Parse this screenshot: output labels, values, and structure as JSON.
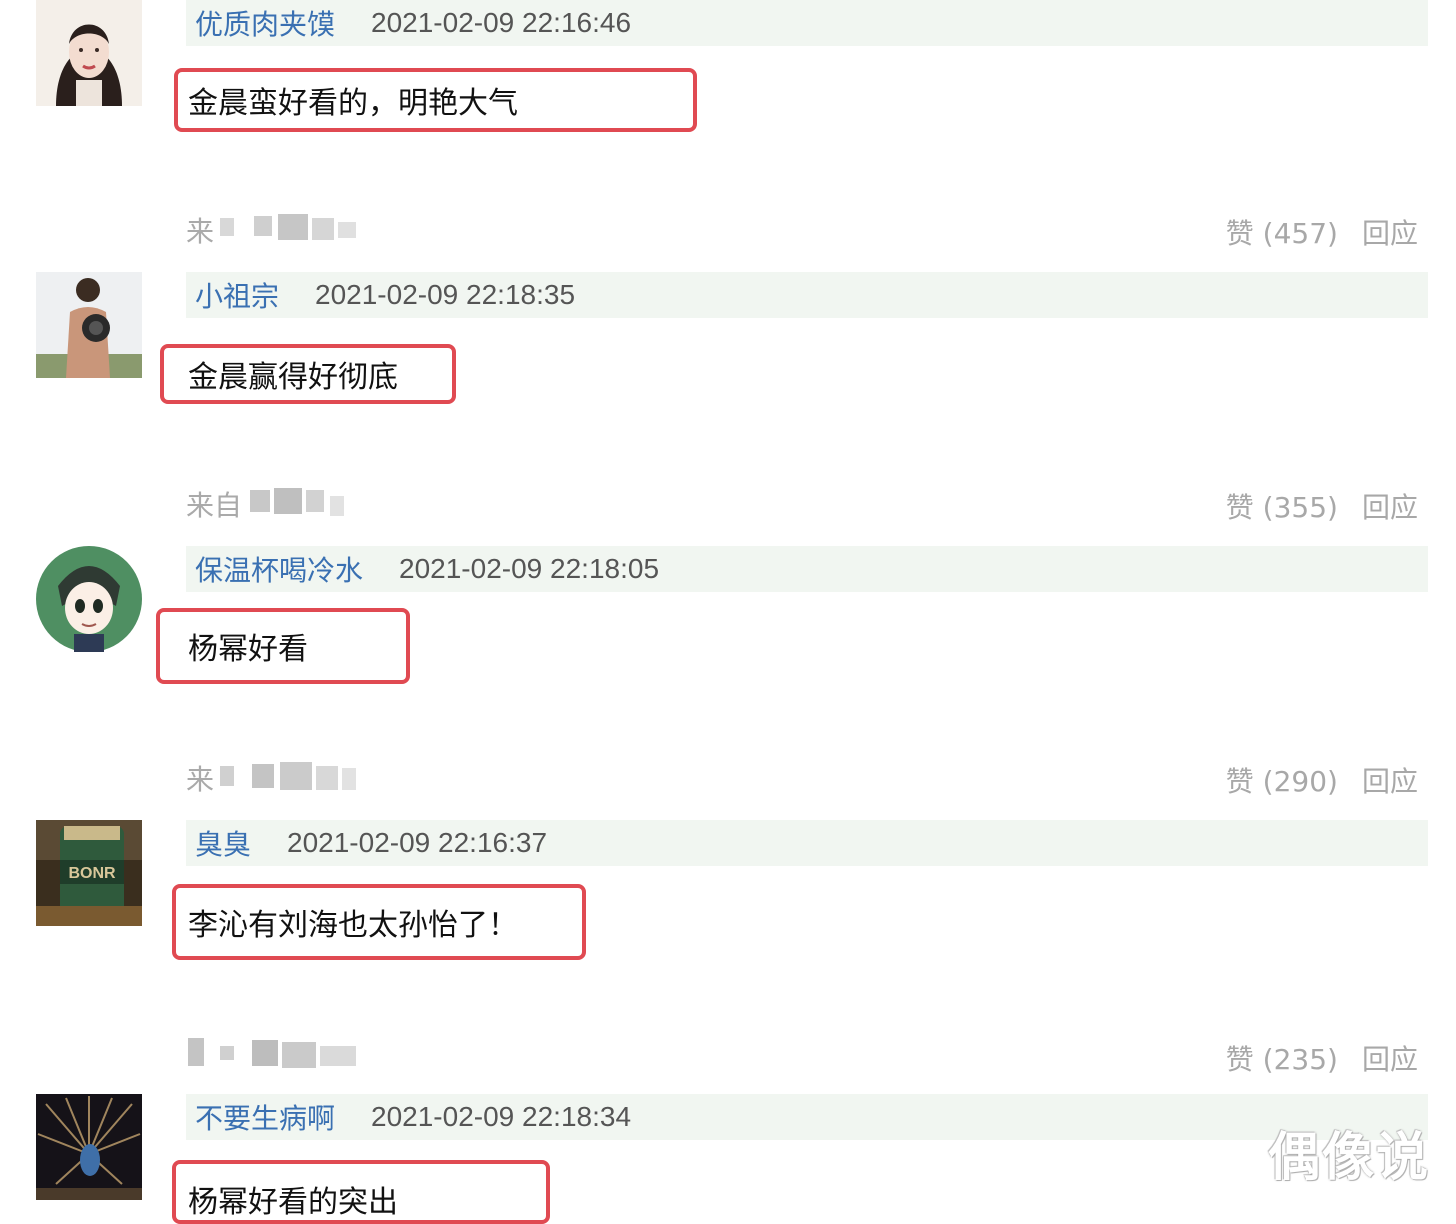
{
  "comments": [
    {
      "username": "优质肉夹馍",
      "timestamp": "2021-02-09 22:16:46",
      "content": "金晨蛮好看的，明艳大气",
      "from_label": "来",
      "likes": "赞 (457)",
      "reply": "回应"
    },
    {
      "username": "小祖宗",
      "timestamp": "2021-02-09 22:18:35",
      "content": "金晨赢得好彻底",
      "from_label": "来自",
      "likes": "赞 (355)",
      "reply": "回应"
    },
    {
      "username": "保温杯喝冷水",
      "timestamp": "2021-02-09 22:18:05",
      "content": "杨幂好看",
      "from_label": "来",
      "likes": "赞 (290)",
      "reply": "回应"
    },
    {
      "username": "臭臭",
      "timestamp": "2021-02-09 22:16:37",
      "content": "李沁有刘海也太孙怡了！",
      "from_label": "",
      "likes": "赞 (235)",
      "reply": "回应"
    },
    {
      "username": "不要生病啊",
      "timestamp": "2021-02-09 22:18:34",
      "content": "杨幂好看的突出"
    }
  ],
  "watermark": "偶像说",
  "colors": {
    "username": "#3a70b2",
    "header_bg": "#f1f6f1",
    "highlight_border": "#e04a52",
    "meta_text": "#a8a8a8"
  }
}
